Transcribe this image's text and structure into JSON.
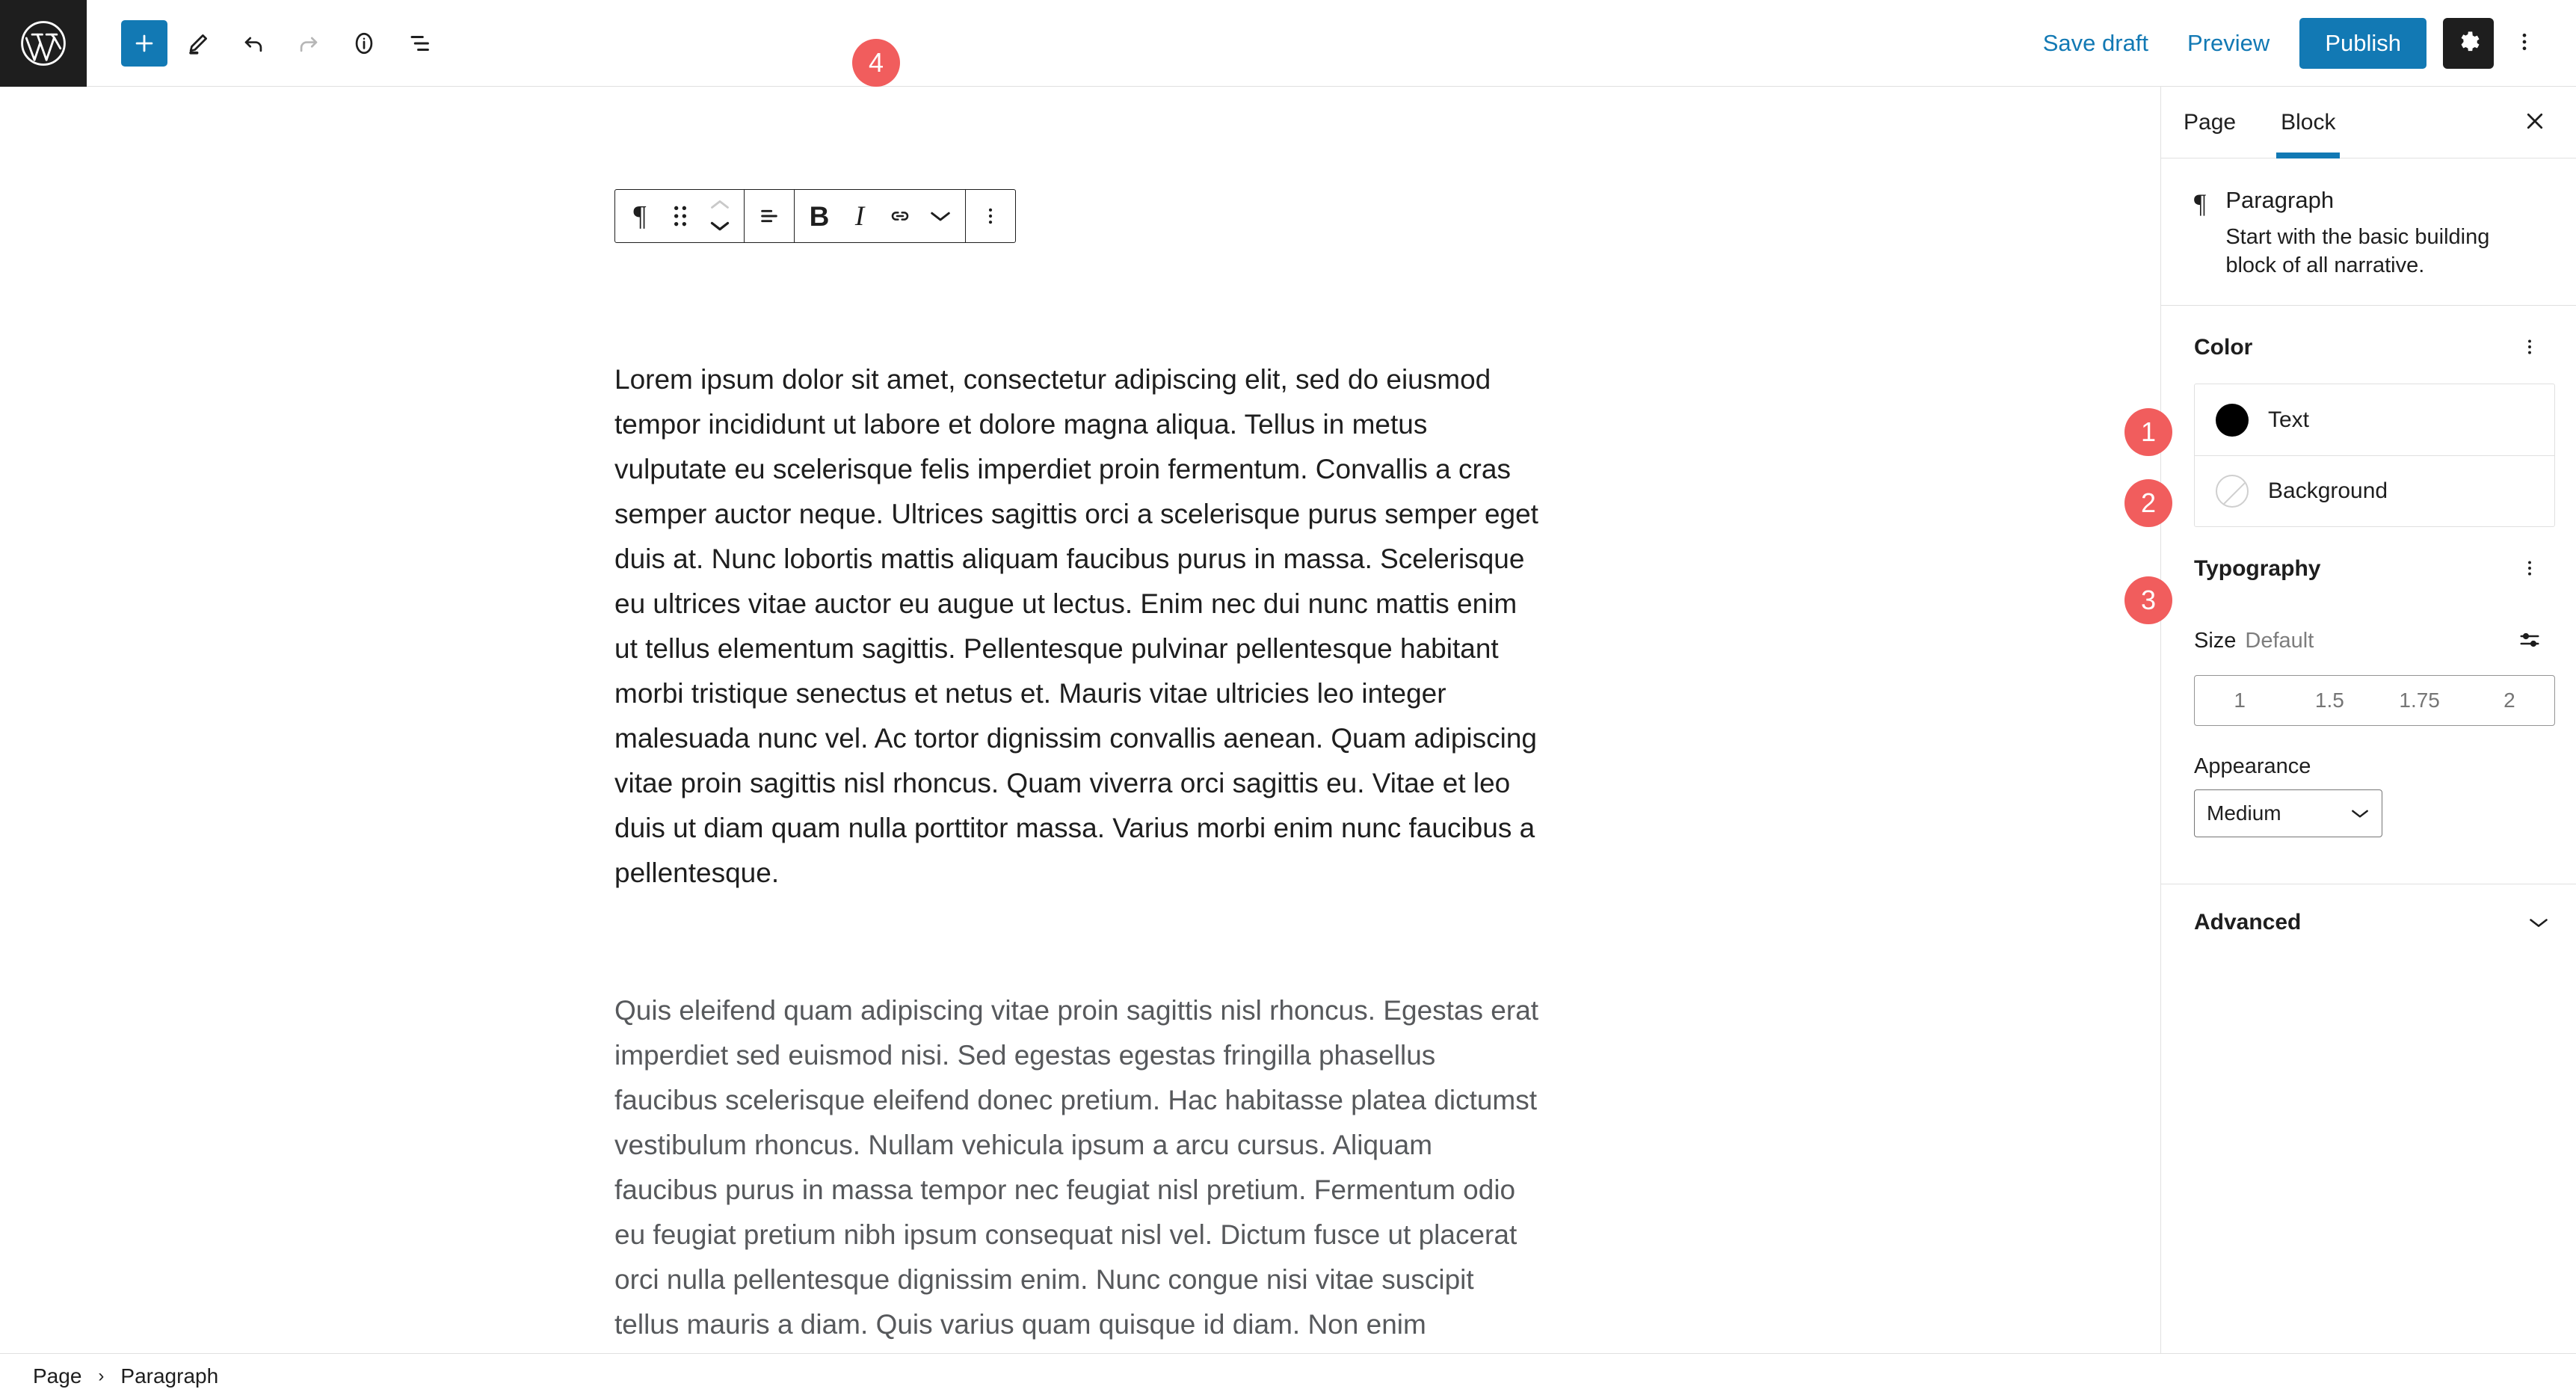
{
  "topbar": {
    "logo_icon": "wordpress-logo-icon",
    "add_block_label": "+",
    "add_block_icon": "plus-icon",
    "tools_icon": "pencil-edit-icon",
    "undo_icon": "undo-arrow-icon",
    "redo_icon": "redo-arrow-icon",
    "details_icon": "info-circle-icon",
    "list_view_icon": "list-view-icon",
    "save_draft_label": "Save draft",
    "preview_label": "Preview",
    "publish_label": "Publish",
    "settings_icon": "gear-icon",
    "options_icon": "kebab-menu-icon",
    "accent_color": "#1279b4",
    "logo_bg_color": "#1e1e1e"
  },
  "block_toolbar": {
    "paragraph_icon": "paragraph-pilcrow-icon",
    "drag_icon": "drag-handle-icon",
    "move_up_icon": "chevron-up-icon",
    "move_down_icon": "chevron-down-icon",
    "align_icon": "align-text-left-icon",
    "bold_label": "B",
    "italic_label": "I",
    "link_icon": "link-icon",
    "more_formats_icon": "chevron-down-icon",
    "options_icon": "kebab-menu-icon"
  },
  "annotations": [
    {
      "id": "1",
      "number": "1",
      "target": "text-color-row"
    },
    {
      "id": "2",
      "number": "2",
      "target": "background-color-row"
    },
    {
      "id": "3",
      "number": "3",
      "target": "typography-panel"
    },
    {
      "id": "4",
      "number": "4",
      "target": "block-toolbar"
    }
  ],
  "annotation_color": "#f15d5d",
  "editor": {
    "paragraph_1": "Lorem ipsum dolor sit amet, consectetur adipiscing elit, sed do eiusmod tempor incididunt ut labore et dolore magna aliqua. Tellus in metus vulputate eu scelerisque felis imperdiet proin fermentum. Convallis a cras semper auctor neque. Ultrices sagittis orci a scelerisque purus semper eget duis at. Nunc lobortis mattis aliquam faucibus purus in massa. Scelerisque eu ultrices vitae auctor eu augue ut lectus. Enim nec dui nunc mattis enim ut tellus elementum sagittis. Pellentesque pulvinar pellentesque habitant morbi tristique senectus et netus et. Mauris vitae ultricies leo integer malesuada nunc vel. Ac tortor dignissim convallis aenean. Quam adipiscing vitae proin sagittis nisl rhoncus. Quam viverra orci sagittis eu. Vitae et leo duis ut diam quam nulla porttitor massa. Varius morbi enim nunc faucibus a pellentesque.",
    "paragraph_2": "Quis eleifend quam adipiscing vitae proin sagittis nisl rhoncus. Egestas erat imperdiet sed euismod nisi. Sed egestas egestas fringilla phasellus faucibus scelerisque eleifend donec pretium. Hac habitasse platea dictumst vestibulum rhoncus. Nullam vehicula ipsum a arcu cursus. Aliquam faucibus purus in massa tempor nec feugiat nisl pretium. Fermentum odio eu feugiat pretium nibh ipsum consequat nisl vel. Dictum fusce ut placerat orci nulla pellentesque dignissim enim. Nunc congue nisi vitae suscipit tellus mauris a diam. Quis varius quam quisque id diam. Non enim praesent elementum facilisis leo vel. At elementum eu facilisis sed"
  },
  "sidebar": {
    "tab_page_label": "Page",
    "tab_block_label": "Block",
    "active_tab": "Block",
    "close_icon": "close-x-icon",
    "block_icon": "paragraph-pilcrow-icon",
    "block_title": "Paragraph",
    "block_description": "Start with the basic building block of all narrative.",
    "color": {
      "panel_title": "Color",
      "options_icon": "kebab-menu-icon",
      "text_label": "Text",
      "text_swatch_color": "#000000",
      "background_label": "Background",
      "background_swatch_color": "none"
    },
    "typography": {
      "panel_title": "Typography",
      "options_icon": "kebab-menu-icon",
      "size_label": "Size",
      "size_value": "Default",
      "custom_size_icon": "sliders-icon",
      "size_options": [
        "1",
        "1.5",
        "1.75",
        "2"
      ],
      "appearance_label": "Appearance",
      "appearance_value": "Medium",
      "appearance_chevron_icon": "chevron-down-icon"
    },
    "advanced": {
      "title": "Advanced",
      "chevron_icon": "chevron-down-icon"
    }
  },
  "bottombar": {
    "crumb_page": "Page",
    "crumb_sep": "›",
    "crumb_block": "Paragraph"
  }
}
